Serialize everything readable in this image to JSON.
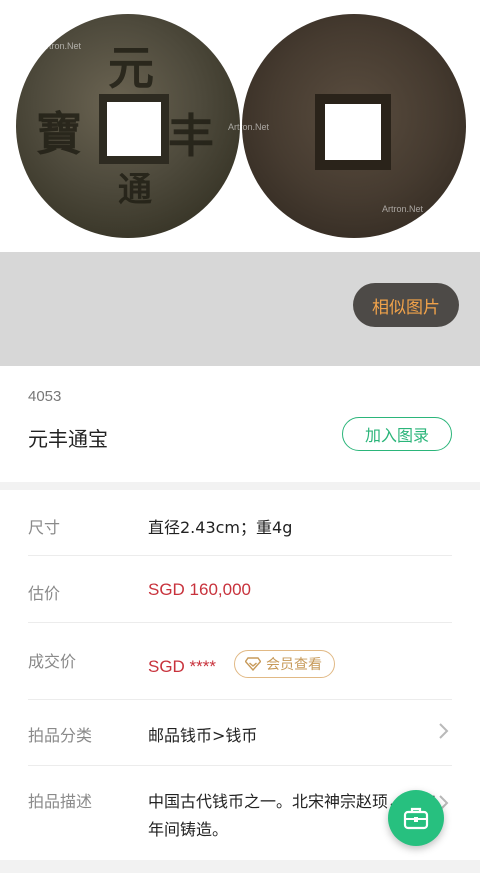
{
  "hero": {
    "front_glyphs": [
      "元",
      "丰",
      "寶",
      "通"
    ],
    "front_mark": "",
    "watermark": "Artron.Net"
  },
  "similar_button": "相似图片",
  "lot": {
    "number": "4053",
    "title": "元丰通宝",
    "add_button": "加入图录"
  },
  "details": {
    "size_label": "尺寸",
    "size_value": "直径2.43cm；重4g",
    "estimate_label": "估价",
    "estimate_value": "SGD  160,000",
    "deal_label": "成交价",
    "deal_value": "SGD ****",
    "member_view": "会员查看",
    "category_label": "拍品分类",
    "category_value": "邮品钱币>钱币",
    "description_label": "拍品描述",
    "description_value": "中国古代钱币之一。北宋神宗赵顼，元丰年间铸造。"
  },
  "colors": {
    "accent_green": "#2bb57a",
    "price_red": "#c8323c",
    "similar_orange": "#f0a24a"
  },
  "icons": {
    "member": "diamond-icon",
    "chevron": "chevron-right-icon",
    "fab": "briefcase-icon"
  }
}
